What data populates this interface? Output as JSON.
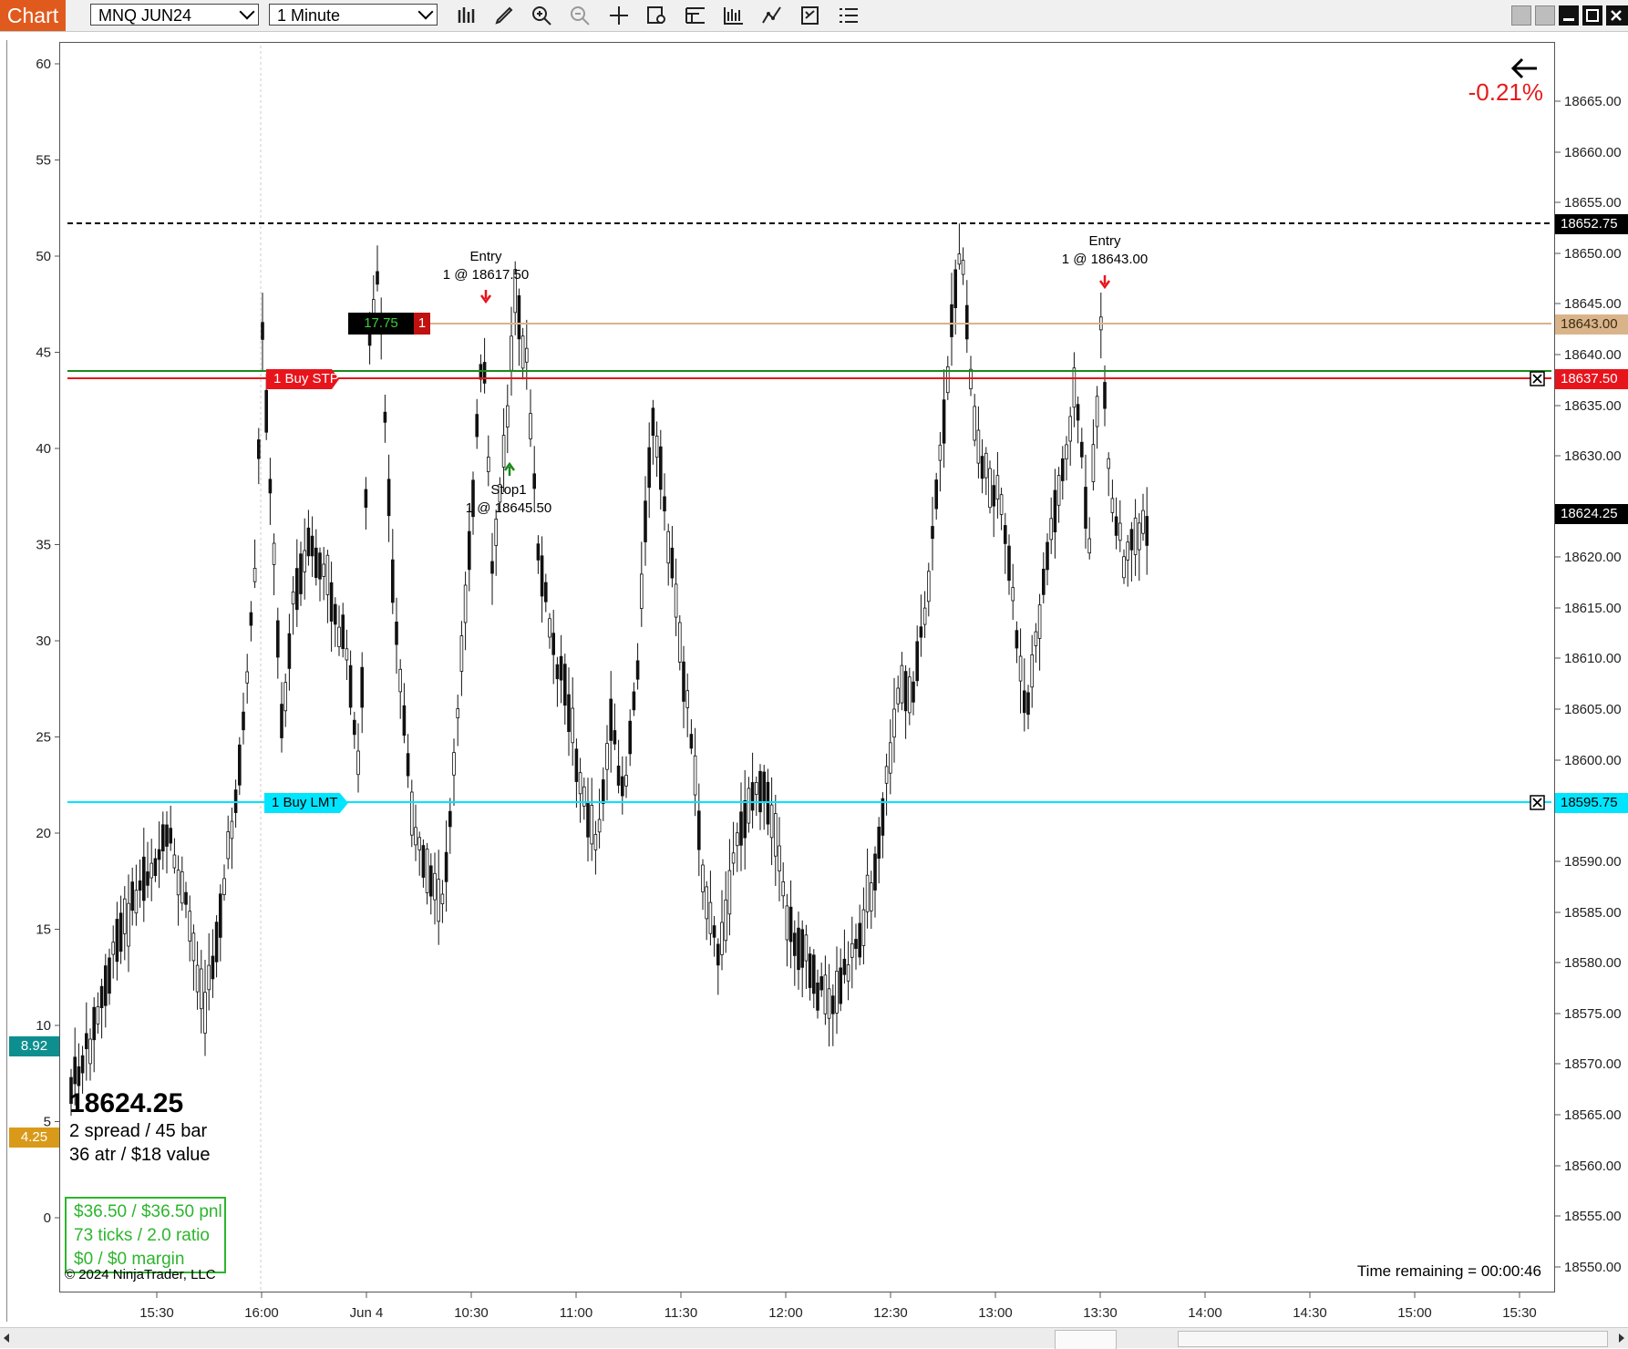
{
  "toolbar": {
    "chart_tab": "Chart",
    "instrument": "MNQ JUN24",
    "interval": "1 Minute",
    "icons": [
      "bar-type-icon",
      "draw-pencil-icon",
      "zoom-in-icon",
      "zoom-out-icon",
      "crosshair-icon",
      "data-box-icon",
      "properties-icon",
      "strategies-icon",
      "indicators-icon",
      "chart-trader-icon",
      "list-icon"
    ],
    "window_buttons": [
      "tile-button",
      "tile-button-2",
      "minimize-button",
      "maximize-button",
      "close-button"
    ]
  },
  "price_axis": {
    "ticks": [
      "18665.00",
      "18660.00",
      "18655.00",
      "18650.00",
      "18645.00",
      "18640.00",
      "18635.00",
      "18630.00",
      "18620.00",
      "18615.00",
      "18610.00",
      "18605.00",
      "18600.00",
      "18590.00",
      "18585.00",
      "18580.00",
      "18575.00",
      "18570.00",
      "18565.00",
      "18560.00",
      "18555.00",
      "18550.00"
    ],
    "badges": {
      "high_line": "18652.75",
      "entry_line": "18643.00",
      "stop_order": "18637.50",
      "last_price": "18624.25",
      "limit_order": "18595.75"
    }
  },
  "indicator_axis": {
    "ticks": [
      "60",
      "55",
      "50",
      "45",
      "40",
      "35",
      "30",
      "25",
      "20",
      "15",
      "10",
      "5",
      "0"
    ],
    "badges": {
      "teal": "8.92",
      "gold": "4.25"
    }
  },
  "time_axis": {
    "ticks": [
      "15:30",
      "16:00",
      "Jun 4",
      "10:30",
      "11:00",
      "11:30",
      "12:00",
      "12:30",
      "13:00",
      "13:30",
      "14:00",
      "14:30",
      "15:00",
      "15:30"
    ]
  },
  "orders": {
    "position_pnl": "17.75",
    "position_qty": "1",
    "stop_label": "1  Buy STP",
    "limit_label": "1  Buy LMT"
  },
  "annotations": {
    "entry1_title": "Entry",
    "entry1_detail": "1 @ 18617.50",
    "stop1_title": "Stop1",
    "stop1_detail": "1 @ 18645.50",
    "entry2_title": "Entry",
    "entry2_detail": "1 @ 18643.00"
  },
  "info": {
    "percent_change": "-0.21%",
    "last_price": "18624.25",
    "spread_line": "2 spread / 45 bar",
    "atr_line": "36 atr / $18 value",
    "pnl_line": "$36.50 / $36.50 pnl",
    "ticks_line": "73 ticks / 2.0 ratio",
    "margin_line": "$0 / $0 margin",
    "copyright": "© 2024 NinjaTrader, LLC",
    "time_remaining": "Time remaining = 00:00:46"
  },
  "colors": {
    "tab": "#e05a1e",
    "stop_red": "#e8141c",
    "limit_cyan": "#00e5ff",
    "entry_tan": "#d9b48a",
    "avg_green": "#1a8a1a",
    "teal_badge": "#0e8f8f",
    "gold_badge": "#d99a1a",
    "pnl_green": "#2db52d"
  }
}
